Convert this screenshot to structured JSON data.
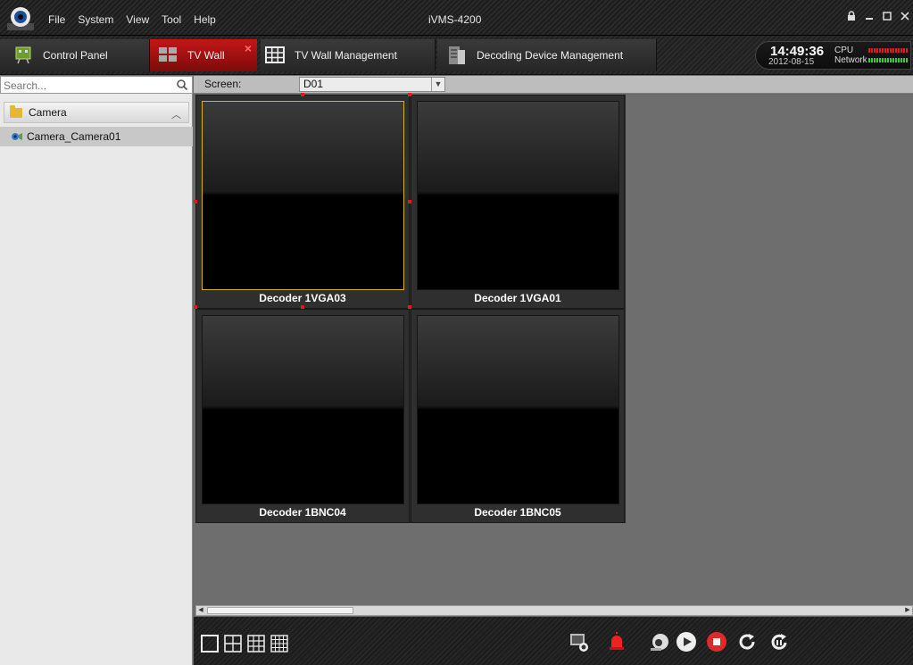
{
  "app": {
    "title": "iVMS-4200",
    "menu": [
      "File",
      "System",
      "View",
      "Tool",
      "Help"
    ]
  },
  "tabs": {
    "control_panel": "Control Panel",
    "tv_wall": "TV Wall",
    "tv_wall_management": "TV Wall Management",
    "decoding_device_management": "Decoding Device Management"
  },
  "status": {
    "time": "14:49:36",
    "date": "2012-08-15",
    "cpu_label": "CPU",
    "network_label": "Network"
  },
  "sidebar": {
    "search_placeholder": "Search...",
    "group": "Camera",
    "items": [
      "Camera_Camera01"
    ]
  },
  "screen": {
    "label": "Screen:",
    "selected": "D01"
  },
  "wall": {
    "cells": [
      "Decoder 1VGA03",
      "Decoder 1VGA01",
      "Decoder 1BNC04",
      "Decoder 1BNC05"
    ]
  },
  "colors": {
    "active_tab": "#c31616",
    "selected_border": "#d4b31a",
    "cpu_bar": "#e01b1b",
    "network_bar": "#2fd22f"
  }
}
